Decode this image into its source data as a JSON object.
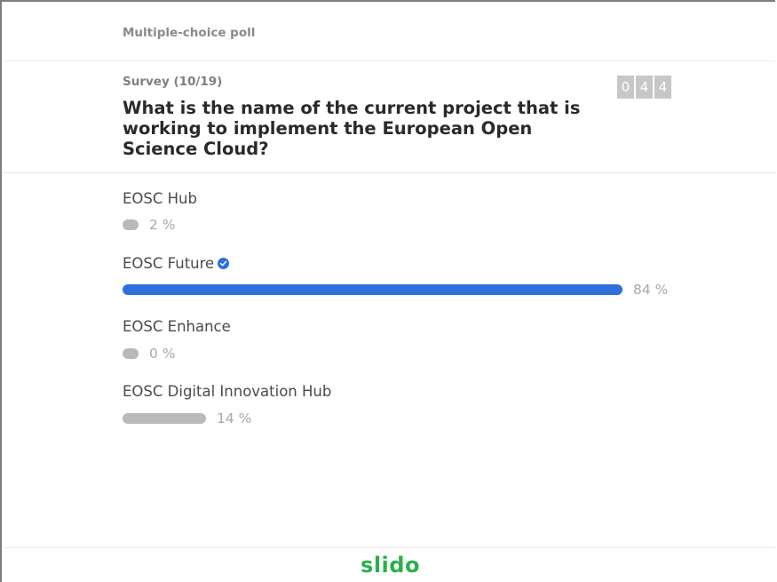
{
  "header": {
    "poll_type": "Multiple-choice poll"
  },
  "question": {
    "survey_label": "Survey (10/19)",
    "text": "What is the name of the current project that is working to implement the European Open Science Cloud?",
    "counter_digits": [
      "0",
      "4",
      "4"
    ]
  },
  "options": [
    {
      "label": "EOSC Hub",
      "percent_text": "2 %",
      "percent": 2,
      "correct": false
    },
    {
      "label": "EOSC Future",
      "percent_text": "84 %",
      "percent": 84,
      "correct": true
    },
    {
      "label": "EOSC Enhance",
      "percent_text": "0 %",
      "percent": 0,
      "correct": false
    },
    {
      "label": "EOSC Digital Innovation Hub",
      "percent_text": "14 %",
      "percent": 14,
      "correct": false
    }
  ],
  "footer": {
    "brand": "slido"
  },
  "colors": {
    "accent": "#2f6fdc",
    "bar_gray": "#b9b9b9",
    "brand_green": "#2ab04b"
  }
}
